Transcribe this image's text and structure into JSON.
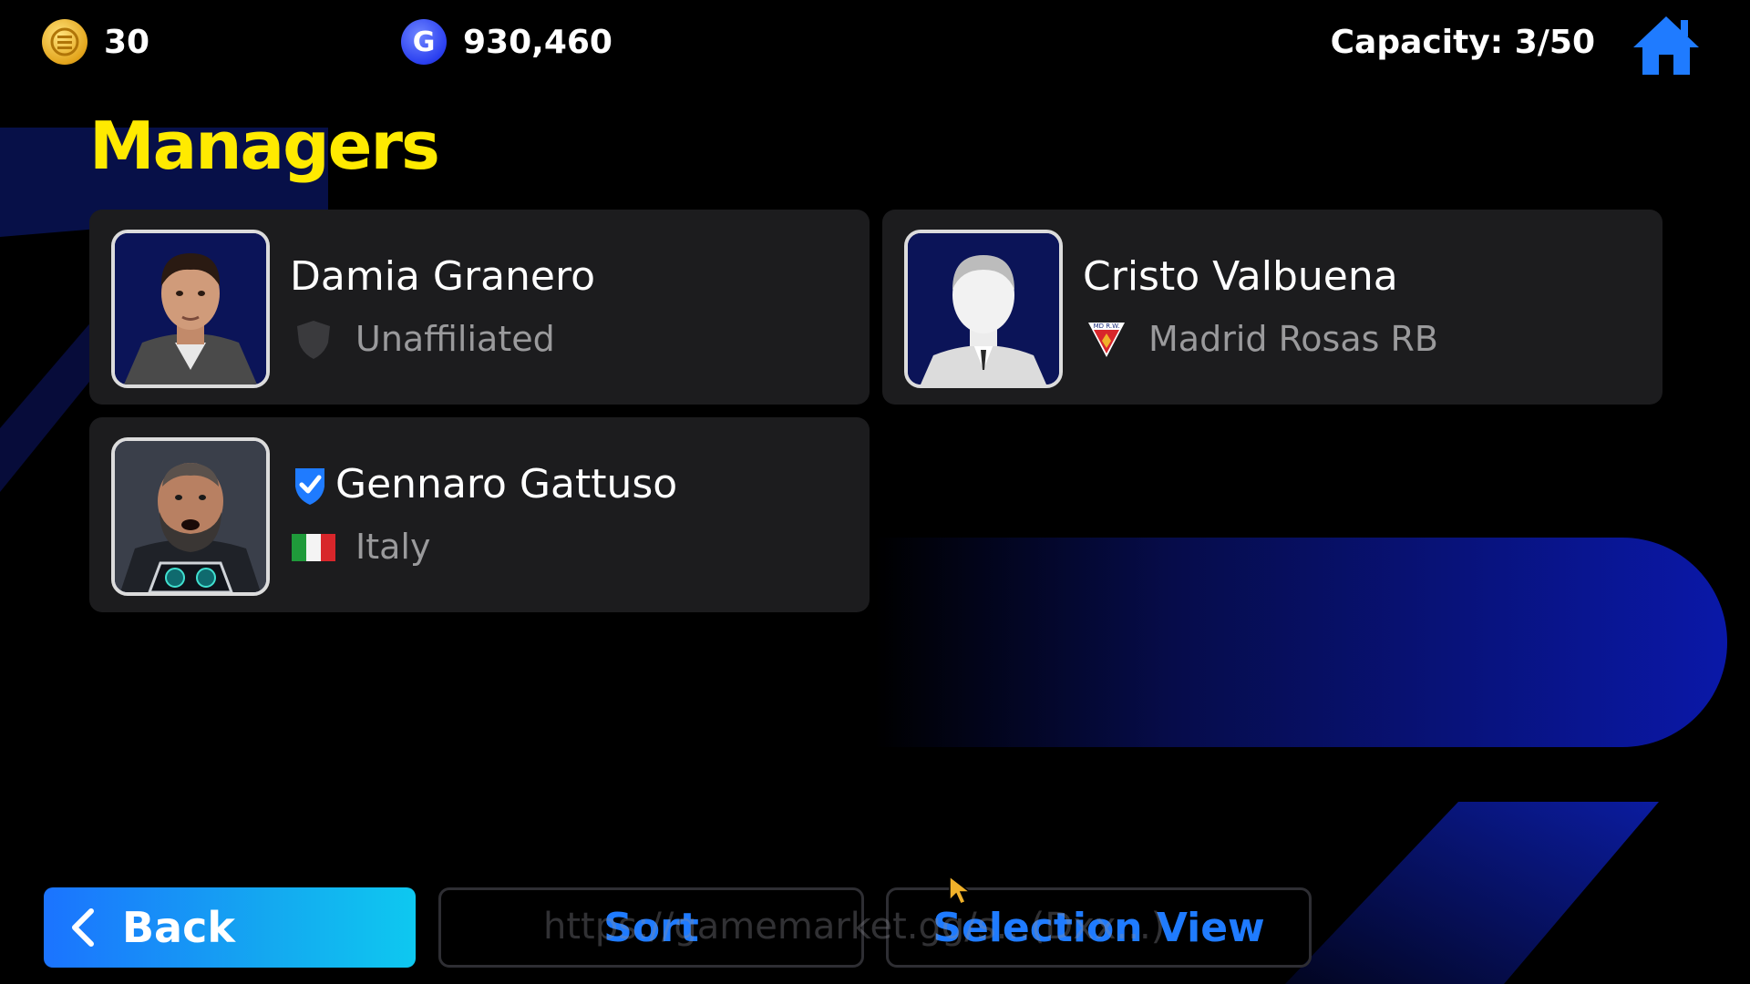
{
  "header": {
    "efootball_coins": "30",
    "gp": "930,460",
    "gp_icon_letter": "G",
    "capacity": "Capacity: 3/50"
  },
  "page": {
    "title": "Managers"
  },
  "managers": [
    {
      "name": "Damia Granero",
      "affiliation": "Unaffiliated",
      "affiliation_icon": "shield-icon"
    },
    {
      "name": "Cristo Valbuena",
      "affiliation": "Madrid Rosas RB",
      "affiliation_icon": "club-crest-icon",
      "crest_text": "MD R.W."
    },
    {
      "name": "Gennaro Gattuso",
      "affiliation": "Italy",
      "affiliation_icon": "italy-flag-icon",
      "verified": true
    }
  ],
  "footer": {
    "back_label": "Back",
    "sort_label": "Sort",
    "selection_view_label": "Selection View",
    "watermark": "https://gamemarket.gg/s...(Dxx...)"
  },
  "colors": {
    "title": "#ffea00",
    "accent_blue": "#1f7bff",
    "card_bg": "#1c1c1e"
  }
}
